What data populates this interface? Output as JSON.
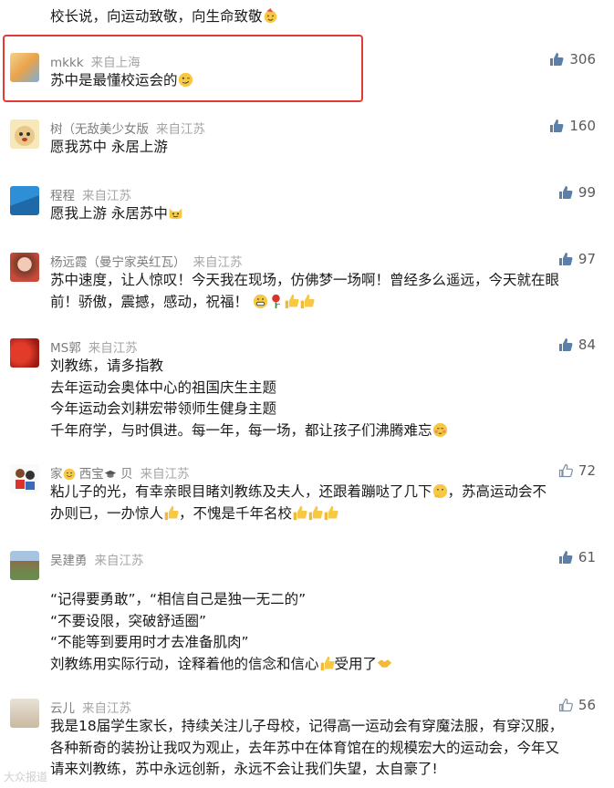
{
  "top_line": "校长说，向运动致敬，向生命致敬",
  "comments": [
    {
      "user": "mkkk",
      "location": "来自上海",
      "likes": "306",
      "text": "苏中是最懂校运会的"
    },
    {
      "user": "树（无敌美少女版",
      "location": "来自江苏",
      "likes": "160",
      "text": "愿我苏中 永居上游"
    },
    {
      "user": "程程",
      "location": "来自江苏",
      "likes": "99",
      "text": "愿我上游 永居苏中"
    },
    {
      "user": "杨远霞（曼宁家英红瓦）",
      "location": "来自江苏",
      "likes": "97",
      "text": "苏中速度，让人惊叹！今天我在现场，仿佛梦一场啊！曾经多么遥远，今天就在眼\n前！骄傲，震撼，感动，祝福！"
    },
    {
      "user": "MS郭",
      "location": "来自江苏",
      "likes": "84",
      "text": "刘教练，请多指教\n去年运动会奥体中心的祖国庆生主题\n今年运动会刘耕宏带领师生健身主题\n千年府学，与时俱进。每一年，每一场，都让孩子们沸腾难忘"
    },
    {
      "user": "家",
      "user_mid": "西宝",
      "user_tail": "贝",
      "location": "来自江苏",
      "likes": "72",
      "text_a": "粘儿子的光，有幸亲眼目睹刘教练及夫人，还跟着蹦哒了几下",
      "text_b": "，苏高运动会不\n办则已，一办惊人",
      "text_c": "，不愧是千年名校"
    },
    {
      "user": "吴建勇",
      "location": "来自江苏",
      "likes": "61",
      "text": "“记得要勇敢”，“相信自己是独一无二的”\n“不要设限，突破舒适圈”\n“不能等到要用时才去准备肌肉”\n刘教练用实际行动，诠释着他的信念和信心",
      "text_tail": "受用了"
    },
    {
      "user": "云儿",
      "location": "来自江苏",
      "likes": "56",
      "text": "我是18届学生家长，持续关注儿子母校，记得高一运动会有穿魔法服，有穿汉服，\n各种新奇的装扮让我叹为观止，去年苏中在体育馆在的规模宏大的运动会，今年又\n请来刘教练，苏中永远创新，永远不会让我们失望，太自豪了!"
    }
  ],
  "watermark": "大众报道"
}
